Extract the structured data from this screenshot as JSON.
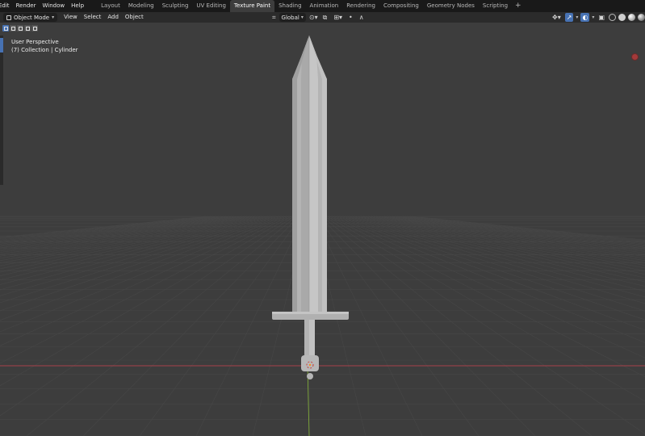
{
  "menu": [
    "Edit",
    "Render",
    "Window",
    "Help"
  ],
  "workspaces": [
    {
      "label": "Layout",
      "active": false
    },
    {
      "label": "Modeling",
      "active": false
    },
    {
      "label": "Sculpting",
      "active": false
    },
    {
      "label": "UV Editing",
      "active": false
    },
    {
      "label": "Texture Paint",
      "active": true
    },
    {
      "label": "Shading",
      "active": false
    },
    {
      "label": "Animation",
      "active": false
    },
    {
      "label": "Rendering",
      "active": false
    },
    {
      "label": "Compositing",
      "active": false
    },
    {
      "label": "Geometry Nodes",
      "active": false
    },
    {
      "label": "Scripting",
      "active": false
    }
  ],
  "workspace_add": "+",
  "viewport_header": {
    "mode": "Object Mode",
    "menus": [
      "View",
      "Select",
      "Add",
      "Object"
    ],
    "orientation": "Global"
  },
  "overlay": {
    "view": "User Perspective",
    "collection": "(7) Collection | Cylinder"
  },
  "colors": {
    "accent": "#4772b3",
    "x_axis": "#a8414a",
    "y_axis": "#7ea83a",
    "viewport_bg": "#3d3d3d",
    "grid": "#4a4a4a",
    "mesh": "#b9b9b9"
  },
  "icons": [
    "object-mode-icon",
    "transform-orientation-icon",
    "pivot-icon",
    "snap-icon",
    "proportional-edit-icon",
    "gizmo-icon",
    "overlay-icon",
    "xray-icon",
    "wireframe-shading-icon",
    "solid-shading-icon",
    "material-shading-icon",
    "rendered-shading-icon"
  ]
}
